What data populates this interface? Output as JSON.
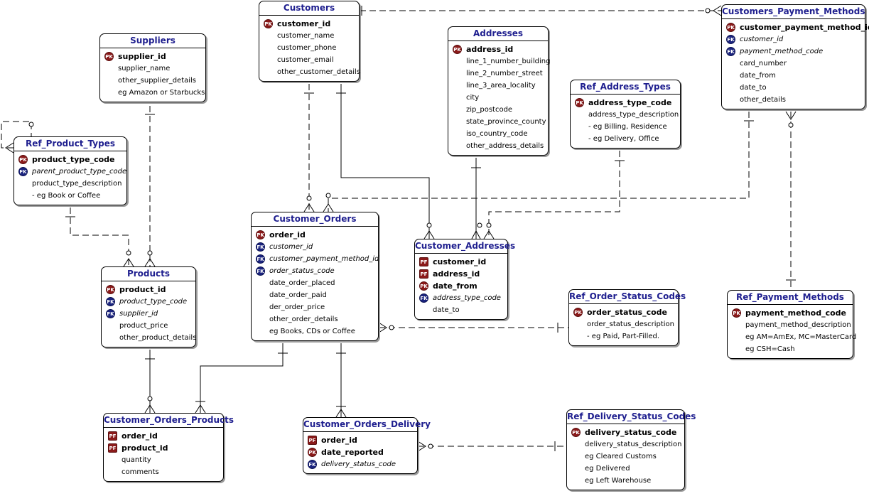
{
  "entities": {
    "suppliers": {
      "title": "Suppliers",
      "fields": [
        {
          "name": "supplier_id",
          "key": "PK"
        },
        {
          "name": "supplier_name",
          "key": ""
        },
        {
          "name": "other_supplier_details",
          "key": ""
        },
        {
          "name": "eg Amazon or Starbucks",
          "key": ""
        }
      ]
    },
    "customers": {
      "title": "Customers",
      "fields": [
        {
          "name": "customer_id",
          "key": "PK"
        },
        {
          "name": "customer_name",
          "key": ""
        },
        {
          "name": "customer_phone",
          "key": ""
        },
        {
          "name": "customer_email",
          "key": ""
        },
        {
          "name": "other_customer_details",
          "key": ""
        }
      ]
    },
    "addresses": {
      "title": "Addresses",
      "fields": [
        {
          "name": "address_id",
          "key": "PK"
        },
        {
          "name": "line_1_number_building",
          "key": ""
        },
        {
          "name": "line_2_number_street",
          "key": ""
        },
        {
          "name": "line_3_area_locality",
          "key": ""
        },
        {
          "name": "city",
          "key": ""
        },
        {
          "name": "zip_postcode",
          "key": ""
        },
        {
          "name": "state_province_county",
          "key": ""
        },
        {
          "name": "iso_country_code",
          "key": ""
        },
        {
          "name": "other_address_details",
          "key": ""
        }
      ]
    },
    "customers_payment_methods": {
      "title": "Customers_Payment_Methods",
      "fields": [
        {
          "name": "customer_payment_method_id",
          "key": "PK"
        },
        {
          "name": "customer_id",
          "key": "FK"
        },
        {
          "name": "payment_method_code",
          "key": "FK"
        },
        {
          "name": "card_number",
          "key": ""
        },
        {
          "name": "date_from",
          "key": ""
        },
        {
          "name": "date_to",
          "key": ""
        },
        {
          "name": "other_details",
          "key": ""
        }
      ]
    },
    "ref_address_types": {
      "title": "Ref_Address_Types",
      "fields": [
        {
          "name": "address_type_code",
          "key": "PK"
        },
        {
          "name": "address_type_description",
          "key": ""
        },
        {
          "name": "- eg Billing, Residence",
          "key": ""
        },
        {
          "name": "- eg Delivery, Office",
          "key": ""
        }
      ]
    },
    "ref_product_types": {
      "title": "Ref_Product_Types",
      "fields": [
        {
          "name": "product_type_code",
          "key": "PK"
        },
        {
          "name": "parent_product_type_code",
          "key": "FK"
        },
        {
          "name": "product_type_description",
          "key": ""
        },
        {
          "name": "- eg Book or Coffee",
          "key": ""
        }
      ]
    },
    "customer_orders": {
      "title": "Customer_Orders",
      "fields": [
        {
          "name": "order_id",
          "key": "PK"
        },
        {
          "name": "customer_id",
          "key": "FK"
        },
        {
          "name": "customer_payment_method_id",
          "key": "FK"
        },
        {
          "name": "order_status_code",
          "key": "FK"
        },
        {
          "name": "date_order_placed",
          "key": ""
        },
        {
          "name": "date_order_paid",
          "key": ""
        },
        {
          "name": "der_order_price",
          "key": ""
        },
        {
          "name": "other_order_details",
          "key": ""
        },
        {
          "name": "eg Books, CDs or Coffee",
          "key": ""
        }
      ]
    },
    "customer_addresses": {
      "title": "Customer_Addresses",
      "fields": [
        {
          "name": "customer_id",
          "key": "PF"
        },
        {
          "name": "address_id",
          "key": "PF"
        },
        {
          "name": "date_from",
          "key": "PK"
        },
        {
          "name": "address_type_code",
          "key": "FK"
        },
        {
          "name": "date_to",
          "key": ""
        }
      ]
    },
    "products": {
      "title": "Products",
      "fields": [
        {
          "name": "product_id",
          "key": "PK"
        },
        {
          "name": "product_type_code",
          "key": "FK"
        },
        {
          "name": "supplier_id",
          "key": "FK"
        },
        {
          "name": "product_price",
          "key": ""
        },
        {
          "name": "other_product_details",
          "key": ""
        }
      ]
    },
    "ref_order_status_codes": {
      "title": "Ref_Order_Status_Codes",
      "fields": [
        {
          "name": "order_status_code",
          "key": "PK"
        },
        {
          "name": "order_status_description",
          "key": ""
        },
        {
          "name": "- eg Paid, Part-Filled.",
          "key": ""
        }
      ]
    },
    "ref_payment_methods": {
      "title": "Ref_Payment_Methods",
      "fields": [
        {
          "name": "payment_method_code",
          "key": "PK"
        },
        {
          "name": "payment_method_description",
          "key": ""
        },
        {
          "name": "eg AM=AmEx, MC=MasterCard",
          "key": ""
        },
        {
          "name": "eg CSH=Cash",
          "key": ""
        }
      ]
    },
    "customer_orders_products": {
      "title": "Customer_Orders_Products",
      "fields": [
        {
          "name": "order_id",
          "key": "PF"
        },
        {
          "name": "product_id",
          "key": "PF"
        },
        {
          "name": "quantity",
          "key": ""
        },
        {
          "name": "comments",
          "key": ""
        }
      ]
    },
    "customer_orders_delivery": {
      "title": "Customer_Orders_Delivery",
      "fields": [
        {
          "name": "order_id",
          "key": "PF"
        },
        {
          "name": "date_reported",
          "key": "PK"
        },
        {
          "name": "delivery_status_code",
          "key": "FK"
        }
      ]
    },
    "ref_delivery_status_codes": {
      "title": "Ref_Delivery_Status_Codes",
      "fields": [
        {
          "name": "delivery_status_code",
          "key": "PK"
        },
        {
          "name": "delivery_status_description",
          "key": ""
        },
        {
          "name": "eg Cleared Customs",
          "key": ""
        },
        {
          "name": "eg Delivered",
          "key": ""
        },
        {
          "name": "eg Left Warehouse",
          "key": ""
        }
      ]
    }
  },
  "colors": {
    "title_text": "#1f1f8f",
    "pk_badge": "#8b1a1a",
    "fk_badge": "#1a237e",
    "line": "#000000"
  }
}
